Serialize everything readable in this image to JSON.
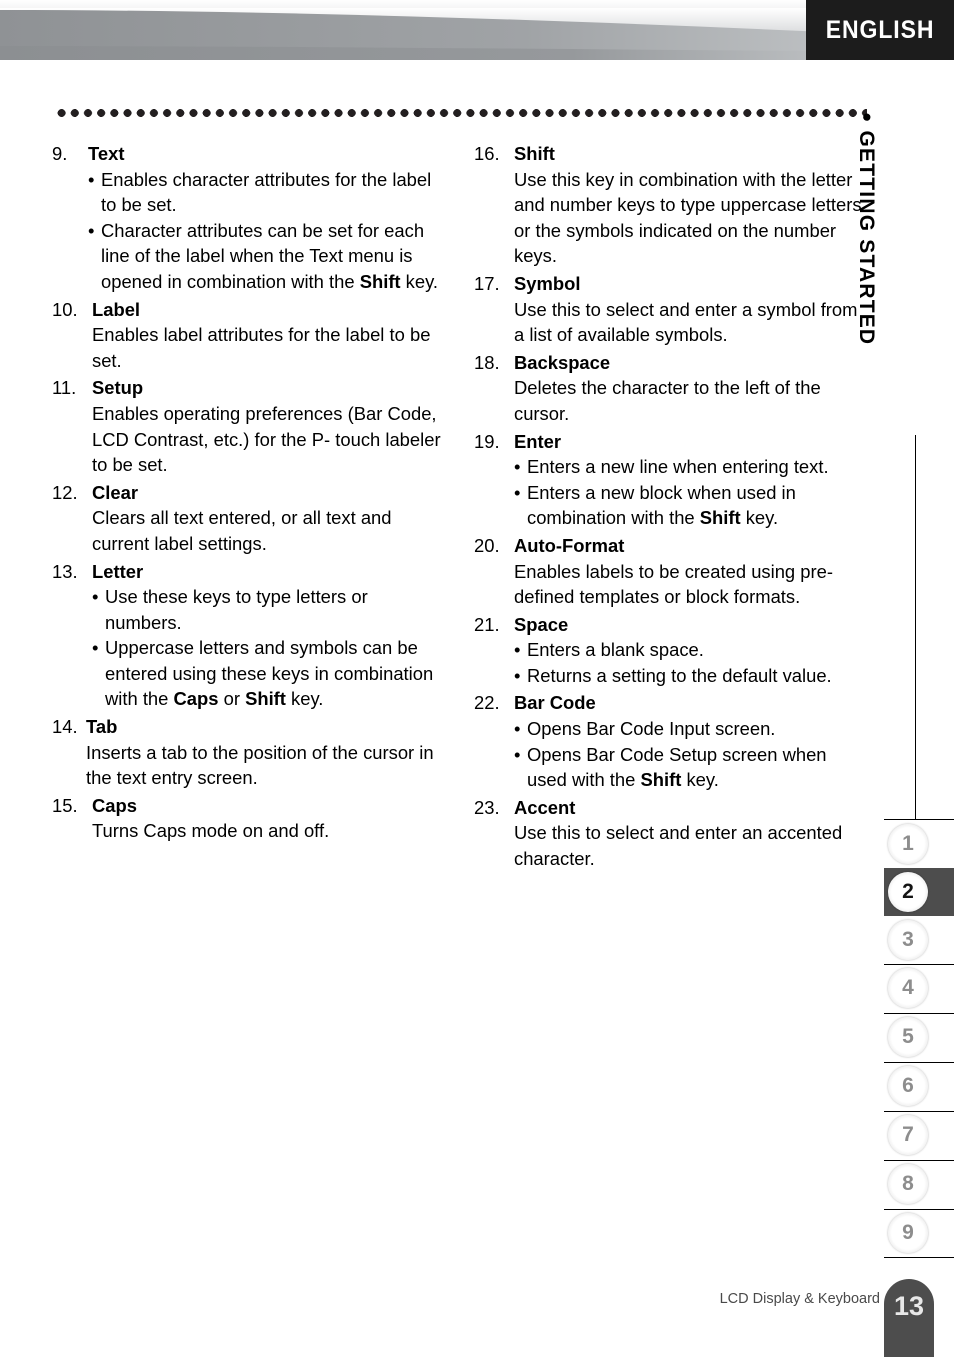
{
  "header": {
    "language_badge": "ENGLISH"
  },
  "sidebar": {
    "chapter_label": "GETTING STARTED",
    "chapter_bullet": "●",
    "tabs": [
      {
        "number": "1",
        "active": false
      },
      {
        "number": "2",
        "active": true
      },
      {
        "number": "3",
        "active": false
      },
      {
        "number": "4",
        "active": false
      },
      {
        "number": "5",
        "active": false
      },
      {
        "number": "6",
        "active": false
      },
      {
        "number": "7",
        "active": false
      },
      {
        "number": "8",
        "active": false
      },
      {
        "number": "9",
        "active": false
      }
    ]
  },
  "footer": {
    "section_title": "LCD Display & Keyboard",
    "page_number": "13"
  },
  "left_column": {
    "i9": {
      "num": "9.",
      "title": "Text",
      "b1_a": "Enables character attributes for the",
      "b1_b": "label to be set.",
      "b2_a": "Character attributes can be set for",
      "b2_b": "each line of the label when the Text",
      "b2_c": "menu is opened in combination with",
      "b2_d_pre": "the ",
      "b2_d_bold": "Shift",
      "b2_d_post": " key."
    },
    "i10": {
      "num": "10.",
      "title": "Label",
      "p_a": "Enables label attributes for the label to",
      "p_b": "be set."
    },
    "i11": {
      "num": "11.",
      "title": "Setup",
      "p_a": "Enables operating preferences (Bar",
      "p_b": "Code, LCD Contrast, etc.) for the P-",
      "p_c": "touch labeler to be set."
    },
    "i12": {
      "num": "12.",
      "title": "Clear",
      "p_a": "Clears all text entered, or all text and",
      "p_b": "current label settings."
    },
    "i13": {
      "num": "13.",
      "title": "Letter",
      "b1_a": "Use these keys to type letters or",
      "b1_b": "numbers.",
      "b2_a": "Uppercase letters and symbols can",
      "b2_b": "be entered using these keys in",
      "b2_c_pre": "combination with the ",
      "b2_c_bold1": "Caps",
      "b2_c_mid": " or ",
      "b2_c_bold2": "Shift",
      "b2_d": "key."
    },
    "i14": {
      "num": "14.",
      "title": "Tab",
      "p_a": "Inserts a tab to the position of the",
      "p_b": "cursor in the text entry screen."
    },
    "i15": {
      "num": "15.",
      "title": "Caps",
      "p_a": "Turns Caps mode on and off."
    }
  },
  "right_column": {
    "i16": {
      "num": "16.",
      "title": "Shift",
      "p_a": "Use this key in combination with the",
      "p_b": "letter and number keys to type",
      "p_c": "uppercase letters or the symbols",
      "p_d": "indicated on the number keys."
    },
    "i17": {
      "num": "17.",
      "title": "Symbol",
      "p_a": "Use this to select and enter a symbol",
      "p_b": "from a list of available symbols."
    },
    "i18": {
      "num": "18.",
      "title": "Backspace",
      "p_a": "Deletes the character to the left of the",
      "p_b": "cursor."
    },
    "i19": {
      "num": "19.",
      "title": "Enter",
      "b1": "Enters a new line when entering text.",
      "b2_a": "Enters a new block when used in",
      "b2_b_pre": "combination with the ",
      "b2_b_bold": "Shift",
      "b2_b_post": " key."
    },
    "i20": {
      "num": "20.",
      "title": "Auto-Format",
      "p_a": "Enables labels to be created using pre-",
      "p_b": "defined templates or block formats."
    },
    "i21": {
      "num": "21.",
      "title": "Space",
      "b1": "Enters a blank space.",
      "b2": "Returns a setting to the default value."
    },
    "i22": {
      "num": "22.",
      "title": "Bar Code",
      "b1": "Opens Bar Code Input screen.",
      "b2_a": "Opens Bar Code Setup screen when",
      "b2_b_pre": "used with the ",
      "b2_b_bold": "Shift",
      "b2_b_post": " key."
    },
    "i23": {
      "num": "23.",
      "title": "Accent",
      "p_a": "Use this to select and enter an",
      "p_b": "accented character."
    }
  },
  "bullet": "•"
}
